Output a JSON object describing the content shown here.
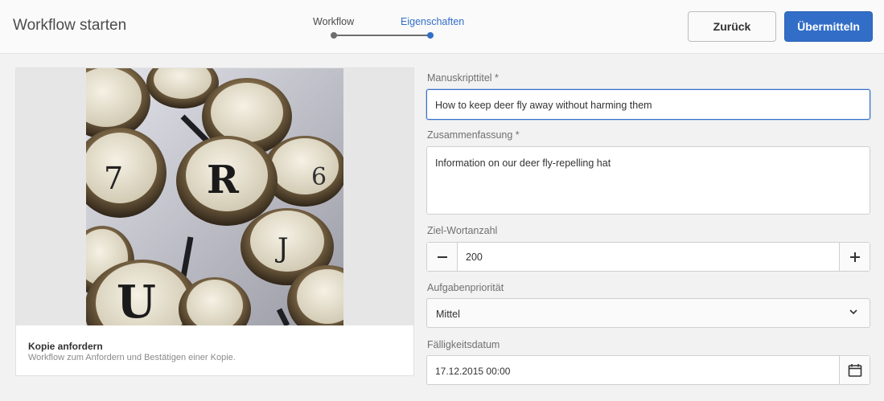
{
  "header": {
    "title": "Workflow starten",
    "steps": [
      {
        "label": "Workflow"
      },
      {
        "label": "Eigenschaften"
      }
    ],
    "back_label": "Zurück",
    "submit_label": "Übermitteln"
  },
  "card": {
    "title": "Kopie anfordern",
    "description": "Workflow zum Anfordern und Bestätigen einer Kopie."
  },
  "form": {
    "manuscript_title": {
      "label": "Manuskripttitel *",
      "value": "How to keep deer fly away without harming them"
    },
    "summary": {
      "label": "Zusammenfassung *",
      "value": "Information on our deer fly-repelling hat"
    },
    "word_count": {
      "label": "Ziel-Wortanzahl",
      "value": "200"
    },
    "priority": {
      "label": "Aufgabenpriorität",
      "value": "Mittel"
    },
    "due_date": {
      "label": "Fälligkeitsdatum",
      "value": "17.12.2015 00:00"
    }
  },
  "colors": {
    "accent": "#326ec8",
    "background": "#f2f2f2"
  }
}
